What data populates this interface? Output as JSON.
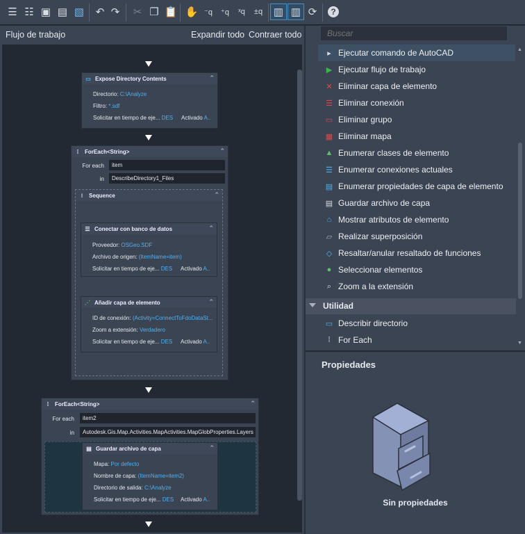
{
  "toolbar": {
    "buttons": [
      "new-workflow",
      "open-workflow",
      "save",
      "save-as",
      "export-image",
      "undo",
      "redo",
      "cut",
      "copy",
      "paste",
      "pan",
      "zoom-out",
      "zoom-in",
      "zoom-extents",
      "zoom-realtime",
      "layout-left",
      "layout-right",
      "refresh",
      "help"
    ]
  },
  "workflow": {
    "title": "Flujo de trabajo",
    "expand_all": "Expandir todo",
    "collapse_all": "Contraer todo"
  },
  "nodes": {
    "expose": {
      "title": "Expose Directory Contents",
      "dir_label": "Directorio:",
      "dir_value": "C:\\Analyze",
      "filter_label": "Filtro:",
      "filter_value": "*.sdf",
      "prompt_label": "Solicitar en tiempo de eje...",
      "prompt_value": "DES",
      "enabled_label": "Activado",
      "enabled_value": "A.."
    },
    "foreach1": {
      "title": "ForEach<String>",
      "foreach_label": "For each",
      "foreach_value": "item",
      "in_label": "in",
      "in_value": "DescribeDirectory1_Files"
    },
    "sequence": {
      "title": "Sequence"
    },
    "connect": {
      "title": "Conectar con banco de datos",
      "provider_label": "Proveedor:",
      "provider_value": "OSGeo.SDF",
      "source_label": "Archivo de origen:",
      "source_value": "(ItemName=item)",
      "prompt_label": "Solicitar en tiempo de eje...",
      "prompt_value": "DES",
      "enabled_label": "Activado",
      "enabled_value": "A.."
    },
    "addlayer": {
      "title": "Añadir capa de elemento",
      "conn_label": "ID de conexión:",
      "conn_value": "(Activity=ConnectToFdoDataSt...",
      "zoom_label": "Zoom a extensión:",
      "zoom_value": "Verdadero",
      "prompt_label": "Solicitar en tiempo de eje...",
      "prompt_value": "DES",
      "enabled_label": "Activado",
      "enabled_value": "A.."
    },
    "foreach2": {
      "title": "ForEach<String>",
      "foreach_label": "For each",
      "foreach_value": "item2",
      "in_label": "in",
      "in_value": "Autodesk.Gis.Map.Activities.MapActivities.MapGlobProperties.Layers"
    },
    "savelayer": {
      "title": "Guardar archivo de capa",
      "map_label": "Mapa:",
      "map_value": "Por defecto",
      "name_label": "Nombre de capa:",
      "name_value": "(ItemName=item2)",
      "out_label": "Directorio de salida:",
      "out_value": "C:\\Analyze",
      "prompt_label": "Solicitar en tiempo de eje...",
      "prompt_value": "DES",
      "enabled_label": "Activado",
      "enabled_value": "A.."
    }
  },
  "toolbox": {
    "search_placeholder": "Buscar",
    "items": [
      "Ejecutar comando de AutoCAD",
      "Ejecutar flujo de trabajo",
      "Eliminar capa de elemento",
      "Eliminar conexión",
      "Eliminar grupo",
      "Eliminar mapa",
      "Enumerar clases de elemento",
      "Enumerar conexiones actuales",
      "Enumerar propiedades de capa de elemento",
      "Guardar archivo de capa",
      "Mostrar atributos de elemento",
      "Realizar superposición",
      "Resaltar/anular resaltado de funciones",
      "Seleccionar elementos",
      "Zoom a la extensión"
    ],
    "selected": "Ejecutar comando de AutoCAD",
    "category": "Utilidad",
    "category_items": [
      "Describir directorio",
      "For Each"
    ]
  },
  "properties": {
    "title": "Propiedades",
    "empty": "Sin propiedades"
  },
  "colors": {
    "accent": "#4fb1ef",
    "panel": "#3b4453",
    "canvas": "#232933"
  }
}
